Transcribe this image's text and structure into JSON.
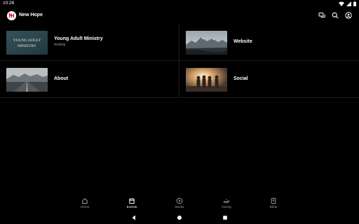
{
  "status_bar": {
    "time": "10:26"
  },
  "app_bar": {
    "title": "New Hope"
  },
  "grid": [
    {
      "title": "Young Adult Ministry",
      "subtitle": "testing",
      "thumb_text_line1": "YOUNG ADULT",
      "thumb_text_line2": "MINISTRY"
    },
    {
      "title": "Website",
      "subtitle": ""
    },
    {
      "title": "About",
      "subtitle": ""
    },
    {
      "title": "Social",
      "subtitle": ""
    }
  ],
  "bottom_nav": [
    {
      "label": "Home",
      "icon": "home-icon",
      "active": false
    },
    {
      "label": "Events",
      "icon": "calendar-icon",
      "active": true
    },
    {
      "label": "Media",
      "icon": "play-icon",
      "active": false
    },
    {
      "label": "Giving",
      "icon": "giving-icon",
      "active": false
    },
    {
      "label": "Bible",
      "icon": "bible-icon",
      "active": false
    }
  ]
}
